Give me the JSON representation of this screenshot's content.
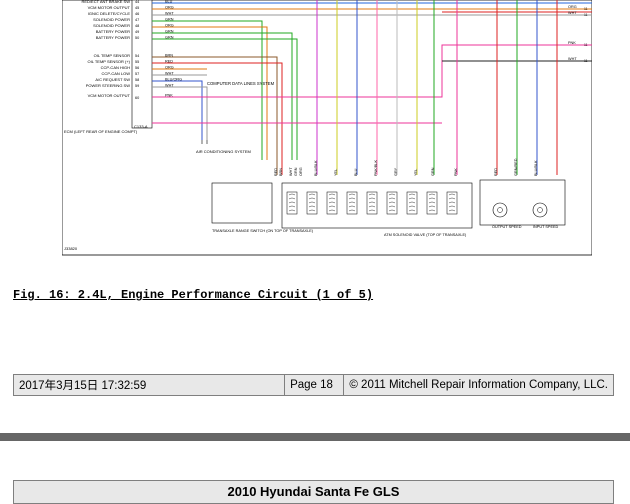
{
  "diagram": {
    "left_labels": [
      "RED/ECT ANT BRAKE SW",
      "VCM MOTOR OUTPUT",
      "IGNIC DELETE/CYCLE",
      "SOLENOID POWER",
      "SOLENOID POWER",
      "BATTERY POWER",
      "BATTERY POWER",
      "OIL TEMP SENSOR",
      "OIL TEMP SENSOR (+)",
      "CCP-CAN HIGH",
      "CCP-CAN LOW",
      "A/C REQUEST SW",
      "POWER STEERING SW",
      "VCM MOTOR OUTPUT"
    ],
    "pin_numbers": [
      "44",
      "45",
      "46",
      "47",
      "48",
      "49",
      "50",
      "",
      "",
      "54",
      "55",
      "56",
      "57",
      "58",
      "59",
      "",
      "60"
    ],
    "wire_colors_left": [
      "BLU",
      "ORG",
      "WHT",
      "GRN",
      "ORG",
      "GRN",
      "GRN",
      "BRN",
      "RED",
      "ORG",
      "WHT",
      "BLU/ORG",
      "WHT",
      "PNK"
    ],
    "computer_data_label": "COMPUTER DATA LINES SYSTEM",
    "ecm_label": "ECM (LEFT REAR OF ENGINE COMPT)",
    "connector_id": "C133-A",
    "ac_label": "AIR CONDITIONING SYSTEM",
    "right_wire_labels": [
      "ORG",
      "WHT",
      "PNK",
      "WHT"
    ],
    "right_pins": [
      "11",
      "11",
      "11",
      "11"
    ],
    "bottom_wire_labels": [
      "RED",
      "BRN",
      "WHT",
      "GRN",
      "ORG",
      "BLU/BLK",
      "YEL",
      "BLU",
      "PNK/BLK",
      "GRY",
      "YEL",
      "GRN",
      "PNK",
      "RED",
      "GRN/RED",
      "BLU/BLK"
    ],
    "transaxle_switch_label": "TRANSAXLE RANGE SWITCH (ON TOP OF TRANSAXLE)",
    "atm_valve_label": "ATM SOLENOID VALVE (TOP OF TRANSAXLE)",
    "output_speed_label": "OUTPUT SPEED",
    "input_speed_label": "INPUT SPEED",
    "figure_id": "J33820"
  },
  "caption": "Fig. 16: 2.4L, Engine Performance Circuit (1 of 5)",
  "footer": {
    "datetime": "2017年3月15日  17:32:59",
    "page": "Page 18",
    "copyright": "© 2011 Mitchell Repair Information Company, LLC."
  },
  "vehicle_title": "2010 Hyundai Santa Fe GLS"
}
